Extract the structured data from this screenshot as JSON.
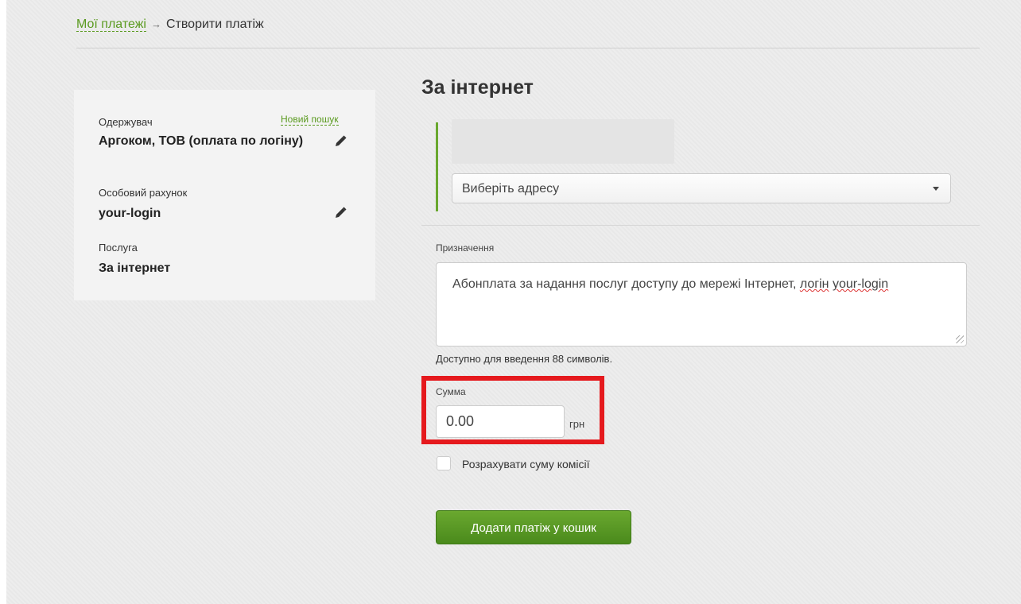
{
  "breadcrumb": {
    "link_label": "Мої платежі",
    "arrow": "→",
    "current": "Створити платіж"
  },
  "sidebar": {
    "recipient_label": "Одержувач",
    "new_search": "Новий пошук",
    "recipient_value": "Аргоком, ТОВ (оплата по логіну)",
    "account_label": "Особовий рахунок",
    "account_value": "your-login",
    "service_label": "Послуга",
    "service_value": "За інтернет"
  },
  "form": {
    "title": "За інтернет",
    "address_placeholder": "Виберіть адресу",
    "purpose_label": "Призначення",
    "purpose_text_main": "Абонплата за надання послуг доступу до мережі Інтернет, ",
    "purpose_text_w1": "логін",
    "purpose_text_w2": "your-login",
    "available_chars": "Доступно для введення 88 символів.",
    "sum_label": "Сумма",
    "sum_value": "0.00",
    "currency": "грн",
    "commission_label": "Розрахувати суму комісії",
    "add_button": "Додати платіж у кошик"
  },
  "colors": {
    "accent_green": "#5a9a1f",
    "button_green": "#4a8a1c",
    "highlight_red": "#e5191d"
  },
  "icons": {
    "pencil": "edit-pencil-icon",
    "caret": "chevron-down-icon"
  }
}
